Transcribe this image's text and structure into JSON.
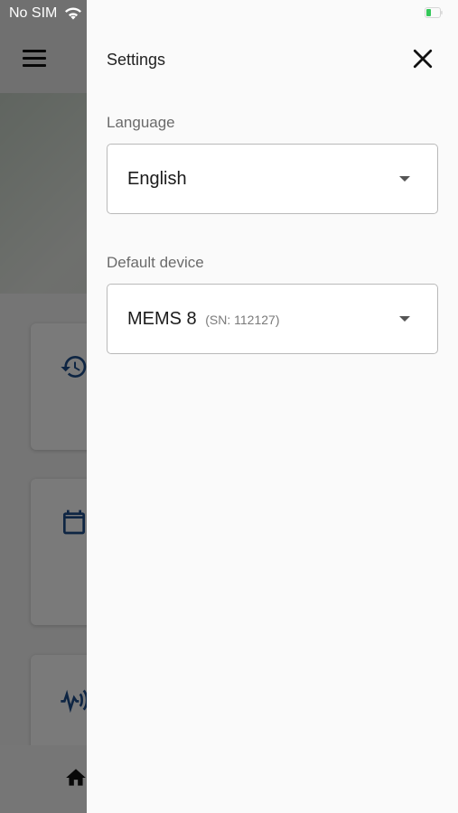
{
  "status_bar": {
    "carrier": "No SIM"
  },
  "drawer": {
    "title": "Settings",
    "language": {
      "label": "Language",
      "value": "English"
    },
    "default_device": {
      "label": "Default device",
      "name": "MEMS 8",
      "serial": "(SN: 112127)"
    }
  },
  "colors": {
    "accent": "#1f4e8c",
    "scrim": "#000000",
    "battery": "#34c759"
  }
}
